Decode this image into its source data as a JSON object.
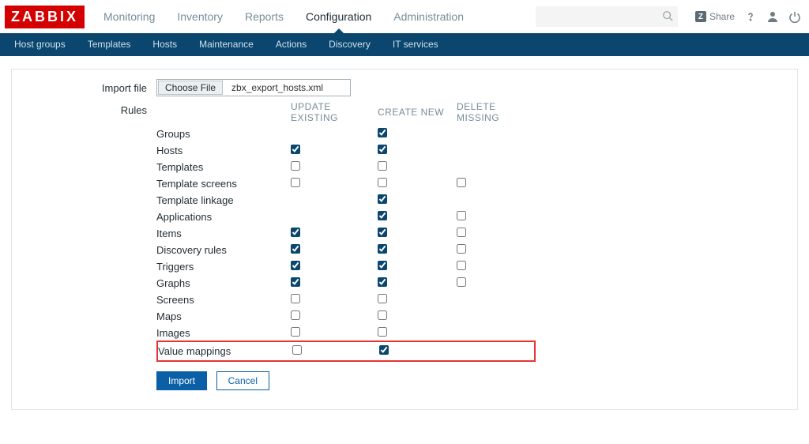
{
  "logo_text": "ZABBIX",
  "mainnav": [
    {
      "label": "Monitoring",
      "active": false
    },
    {
      "label": "Inventory",
      "active": false
    },
    {
      "label": "Reports",
      "active": false
    },
    {
      "label": "Configuration",
      "active": true
    },
    {
      "label": "Administration",
      "active": false
    }
  ],
  "share_label": "Share",
  "subnav": [
    "Host groups",
    "Templates",
    "Hosts",
    "Maintenance",
    "Actions",
    "Discovery",
    "IT services"
  ],
  "form": {
    "import_file_label": "Import file",
    "choose_file_btn": "Choose File",
    "file_name": "zbx_export_hosts.xml",
    "rules_label": "Rules",
    "col_update": "UPDATE EXISTING",
    "col_create": "CREATE NEW",
    "col_delete": "DELETE MISSING",
    "rules": [
      {
        "name": "Groups",
        "update": null,
        "create": true,
        "delete": null
      },
      {
        "name": "Hosts",
        "update": true,
        "create": true,
        "delete": null
      },
      {
        "name": "Templates",
        "update": false,
        "create": false,
        "delete": null
      },
      {
        "name": "Template screens",
        "update": false,
        "create": false,
        "delete": false
      },
      {
        "name": "Template linkage",
        "update": null,
        "create": true,
        "delete": null
      },
      {
        "name": "Applications",
        "update": null,
        "create": true,
        "delete": false
      },
      {
        "name": "Items",
        "update": true,
        "create": true,
        "delete": false
      },
      {
        "name": "Discovery rules",
        "update": true,
        "create": true,
        "delete": false
      },
      {
        "name": "Triggers",
        "update": true,
        "create": true,
        "delete": false
      },
      {
        "name": "Graphs",
        "update": true,
        "create": true,
        "delete": false
      },
      {
        "name": "Screens",
        "update": false,
        "create": false,
        "delete": null
      },
      {
        "name": "Maps",
        "update": false,
        "create": false,
        "delete": null
      },
      {
        "name": "Images",
        "update": false,
        "create": false,
        "delete": null
      },
      {
        "name": "Value mappings",
        "update": false,
        "create": true,
        "delete": null,
        "highlighted": true
      }
    ],
    "import_btn": "Import",
    "cancel_btn": "Cancel"
  }
}
